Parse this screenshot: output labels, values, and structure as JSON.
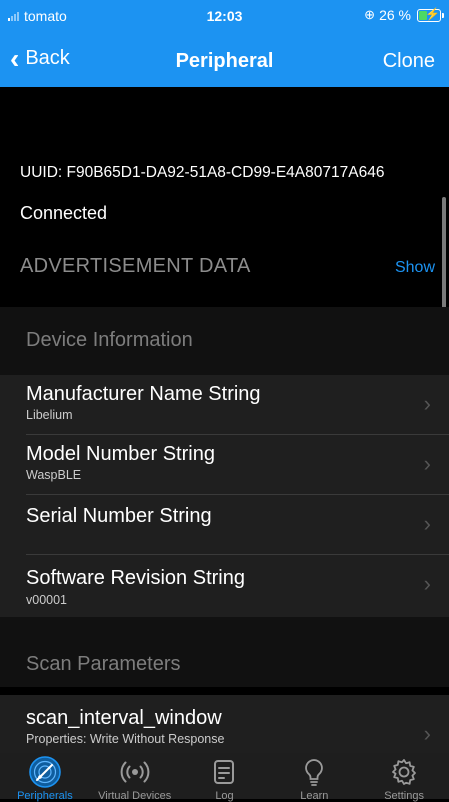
{
  "status_bar": {
    "carrier": "tomato",
    "time": "12:03",
    "battery": "26 %"
  },
  "nav": {
    "back_label": "Back",
    "title": "Peripheral",
    "clone_label": "Clone"
  },
  "device": {
    "uuid": "UUID: F90B65D1-DA92-51A8-CD99-E4A80717A646",
    "state": "Connected"
  },
  "advertisement": {
    "label": "ADVERTISEMENT DATA",
    "show_label": "Show"
  },
  "sections": [
    {
      "title": "Device Information",
      "items": [
        {
          "name": "Manufacturer Name String",
          "value": "Libelium"
        },
        {
          "name": "Model Number String",
          "value": "WaspBLE"
        },
        {
          "name": "Serial Number String",
          "value": ""
        },
        {
          "name": "Software Revision String",
          "value": "v00001"
        }
      ]
    },
    {
      "title": "Scan Parameters",
      "items": [
        {
          "name": "scan_interval_window",
          "value": "Properties: Write Without Response"
        }
      ]
    }
  ],
  "tabs": [
    {
      "label": "Peripherals",
      "icon": "peripherals-icon",
      "active": true
    },
    {
      "label": "Virtual Devices",
      "icon": "broadcast-icon",
      "active": false
    },
    {
      "label": "Log",
      "icon": "log-icon",
      "active": false
    },
    {
      "label": "Learn",
      "icon": "lightbulb-icon",
      "active": false
    },
    {
      "label": "Settings",
      "icon": "gear-icon",
      "active": false
    }
  ],
  "colors": {
    "accent": "#1c93f2",
    "background": "#000000",
    "row_background": "#1f1f1f",
    "secondary_text": "#8c8c8c"
  }
}
